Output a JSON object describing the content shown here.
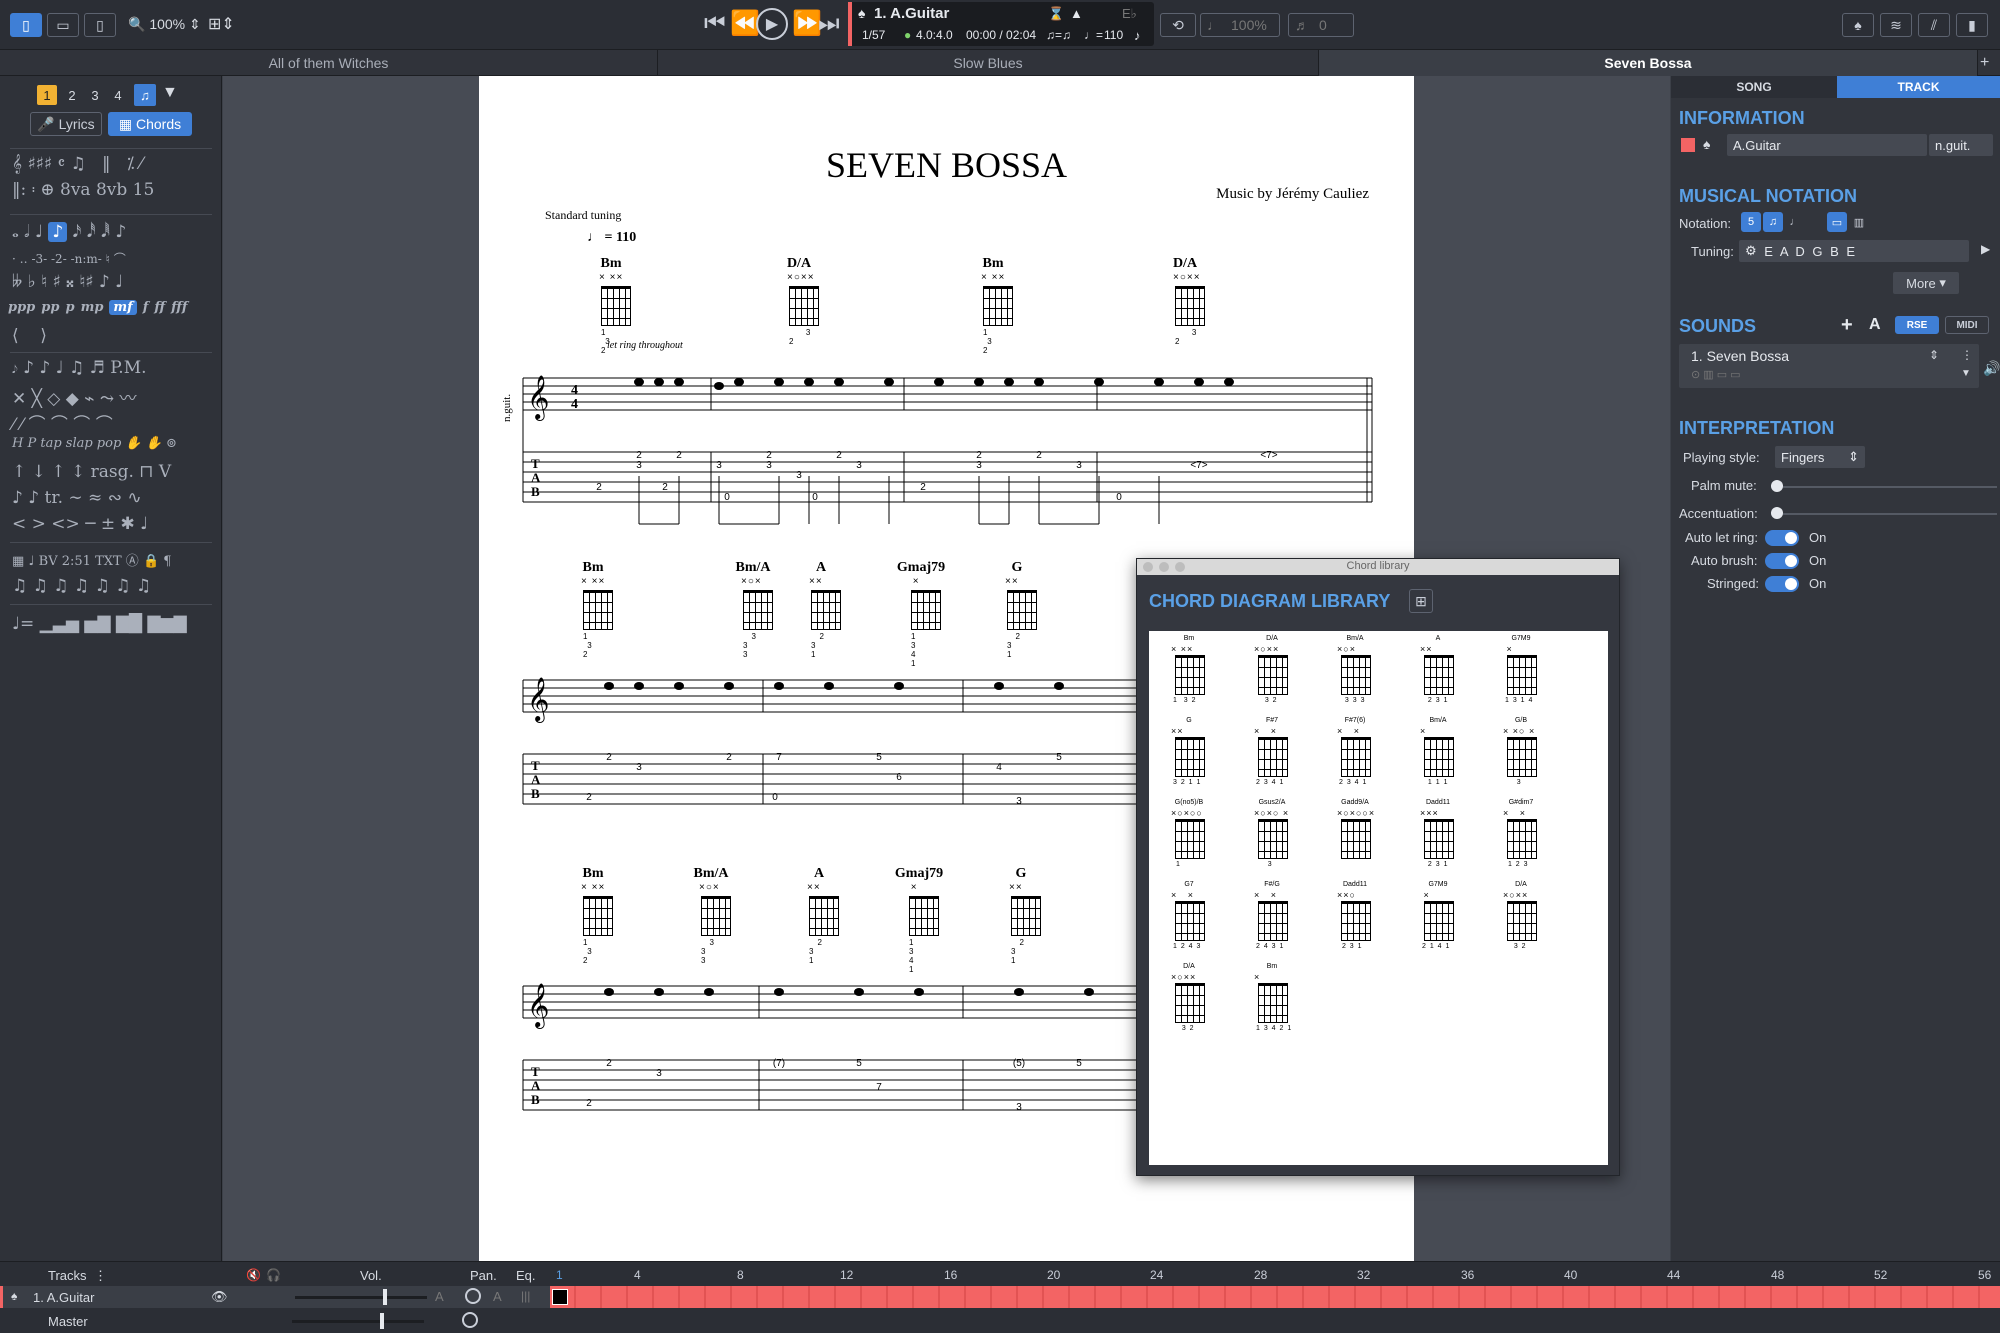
{
  "toolbar": {
    "zoom": "100%",
    "track_name": "1. A.Guitar",
    "bar_position": "1/57",
    "signature": "4.0:4.0",
    "time": "00:00 / 02:04",
    "tempo": "110",
    "key": "E♭",
    "pitch_pct": "100%",
    "count": "0"
  },
  "tabs": [
    "All of them Witches",
    "Slow Blues",
    "Seven Bossa"
  ],
  "palette": {
    "voices": [
      "1",
      "2",
      "3",
      "4"
    ],
    "lyrics_label": "Lyrics",
    "chords_label": "Chords",
    "dynamics": [
      "ppp",
      "pp",
      "p",
      "mp",
      "mf",
      "f",
      "ff",
      "fff"
    ]
  },
  "score": {
    "title": "SEVEN BOSSA",
    "composer": "Music by Jérémy Cauliez",
    "tuning": "Standard tuning",
    "tempo_mark": "= 110",
    "let_ring": "let ring throughout",
    "instrument": "n.guit.",
    "system1_chords": [
      "Bm",
      "D/A",
      "Bm",
      "D/A"
    ],
    "system2_chords": [
      "Bm",
      "Bm/A",
      "A",
      "Gmaj79",
      "G"
    ],
    "system3_chords": [
      "Bm",
      "Bm/A",
      "A",
      "Gmaj79",
      "G"
    ]
  },
  "chord_library": {
    "window_title": "Chord library",
    "heading": "CHORD DIAGRAM LIBRARY",
    "chords": [
      "Bm",
      "D/A",
      "Bm/A",
      "A",
      "G7M9",
      "G",
      "F#7",
      "F#7(6)",
      "Bm/A",
      "G/B",
      "G(no5)/B",
      "Gsus2/A",
      "Gadd9/A",
      "Dadd11",
      "G#dim7",
      "G7",
      "F#/G",
      "Dadd11",
      "G7M9",
      "D/A",
      "D/A",
      "Bm"
    ]
  },
  "inspector": {
    "tab_song": "SONG",
    "tab_track": "TRACK",
    "information": "INFORMATION",
    "track_name": "A.Guitar",
    "track_short": "n.guit.",
    "musical_notation": "MUSICAL NOTATION",
    "notation_label": "Notation:",
    "tuning_label": "Tuning:",
    "tuning_value": "E A D G B E",
    "more": "More",
    "sounds": "SOUNDS",
    "rse": "RSE",
    "midi": "MIDI",
    "sound_name": "1. Seven Bossa",
    "interpretation": "INTERPRETATION",
    "playing_style_label": "Playing style:",
    "playing_style": "Fingers",
    "palm_mute_label": "Palm mute:",
    "accentuation_label": "Accentuation:",
    "auto_let_ring_label": "Auto let ring:",
    "auto_brush_label": "Auto brush:",
    "stringed_label": "Stringed:",
    "on": "On"
  },
  "tracks": {
    "header": "Tracks",
    "vol": "Vol.",
    "pan": "Pan.",
    "eq": "Eq.",
    "track1": "1. A.Guitar",
    "master": "Master",
    "bar_numbers": [
      "1",
      "4",
      "8",
      "12",
      "16",
      "20",
      "24",
      "28",
      "32",
      "36",
      "40",
      "44",
      "48",
      "52",
      "56"
    ]
  },
  "colors": {
    "accent": "#3f7fd6",
    "header_blue": "#5aa0e6",
    "track_red": "#f36464"
  }
}
